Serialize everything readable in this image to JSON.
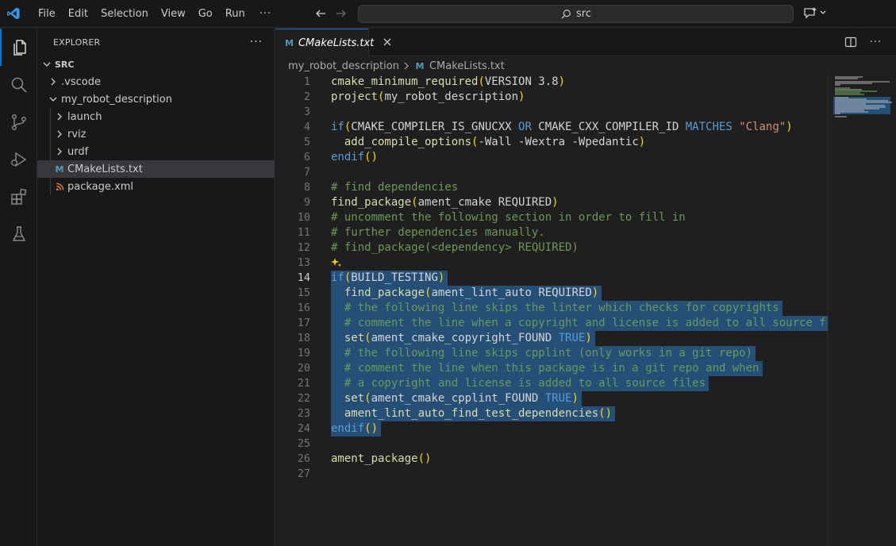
{
  "menu": {
    "file": "File",
    "edit": "Edit",
    "selection": "Selection",
    "view": "View",
    "go": "Go",
    "run": "Run",
    "more": "···"
  },
  "search": {
    "text": "src"
  },
  "explorer": {
    "title": "EXPLORER",
    "root": "SRC",
    "items": [
      {
        "label": ".vscode"
      },
      {
        "label": "my_robot_description"
      },
      {
        "label": "launch"
      },
      {
        "label": "rviz"
      },
      {
        "label": "urdf"
      },
      {
        "label": "CMakeLists.txt"
      },
      {
        "label": "package.xml"
      }
    ]
  },
  "tab": {
    "label": "CMakeLists.txt",
    "icon_letter": "M"
  },
  "breadcrumbs": {
    "folder": "my_robot_description",
    "file": "CMakeLists.txt"
  },
  "colors": {
    "accent": "#0078d4",
    "selection": "#264f78",
    "keyword": "#569cd6",
    "function": "#dcdcaa",
    "comment": "#6a9955",
    "string": "#ce9178"
  },
  "editor": {
    "current_line": 14,
    "lines": [
      {
        "n": "1",
        "tokens": [
          [
            "fn",
            "cmake_minimum_required"
          ],
          [
            "pr",
            "("
          ],
          [
            "pl",
            "VERSION 3.8"
          ],
          [
            "pr",
            ")"
          ]
        ]
      },
      {
        "n": "2",
        "tokens": [
          [
            "fn",
            "project"
          ],
          [
            "pr",
            "("
          ],
          [
            "pl",
            "my_robot_description"
          ],
          [
            "pr",
            ")"
          ]
        ]
      },
      {
        "n": "3",
        "tokens": []
      },
      {
        "n": "4",
        "tokens": [
          [
            "kw",
            "if"
          ],
          [
            "pr",
            "("
          ],
          [
            "pl",
            "CMAKE_COMPILER_IS_GNUCXX "
          ],
          [
            "kw",
            "OR"
          ],
          [
            "pl",
            " CMAKE_CXX_COMPILER_ID "
          ],
          [
            "kw",
            "MATCHES"
          ],
          [
            "pl",
            " "
          ],
          [
            "st",
            "\"Clang\""
          ],
          [
            "pr",
            ")"
          ]
        ]
      },
      {
        "n": "5",
        "tokens": [
          [
            "pl",
            "  "
          ],
          [
            "fn",
            "add_compile_options"
          ],
          [
            "pr",
            "("
          ],
          [
            "pl",
            "-Wall -Wextra -Wpedantic"
          ],
          [
            "pr",
            ")"
          ]
        ]
      },
      {
        "n": "6",
        "tokens": [
          [
            "kw",
            "endif"
          ],
          [
            "pr",
            "()"
          ]
        ]
      },
      {
        "n": "7",
        "tokens": []
      },
      {
        "n": "8",
        "tokens": [
          [
            "cm",
            "# find dependencies"
          ]
        ]
      },
      {
        "n": "9",
        "tokens": [
          [
            "fn",
            "find_package"
          ],
          [
            "pr",
            "("
          ],
          [
            "pl",
            "ament_cmake REQUIRED"
          ],
          [
            "pr",
            ")"
          ]
        ]
      },
      {
        "n": "10",
        "tokens": [
          [
            "cm",
            "# uncomment the following section in order to fill in"
          ]
        ]
      },
      {
        "n": "11",
        "tokens": [
          [
            "cm",
            "# further dependencies manually."
          ]
        ]
      },
      {
        "n": "12",
        "tokens": [
          [
            "cm",
            "# find_package(<dependency> REQUIRED)"
          ]
        ]
      },
      {
        "n": "13",
        "tokens": []
      },
      {
        "n": "14",
        "tokens": [
          [
            "kw",
            "if"
          ],
          [
            "pr",
            "("
          ],
          [
            "pl",
            "BUILD_TESTING"
          ],
          [
            "pr",
            ")"
          ]
        ]
      },
      {
        "n": "15",
        "tokens": [
          [
            "pl",
            "  "
          ],
          [
            "fn",
            "find_package"
          ],
          [
            "pr",
            "("
          ],
          [
            "pl",
            "ament_lint_auto REQUIRED"
          ],
          [
            "pr",
            ")"
          ]
        ]
      },
      {
        "n": "16",
        "tokens": [
          [
            "pl",
            "  "
          ],
          [
            "cm",
            "# the following line skips the linter which checks for copyrights"
          ]
        ]
      },
      {
        "n": "17",
        "tokens": [
          [
            "pl",
            "  "
          ],
          [
            "cm",
            "# comment the line when a copyright and license is added to all source f"
          ]
        ]
      },
      {
        "n": "18",
        "tokens": [
          [
            "pl",
            "  "
          ],
          [
            "fn",
            "set"
          ],
          [
            "pr",
            "("
          ],
          [
            "pl",
            "ament_cmake_copyright_FOUND "
          ],
          [
            "kw",
            "TRUE"
          ],
          [
            "pr",
            ")"
          ]
        ]
      },
      {
        "n": "19",
        "tokens": [
          [
            "pl",
            "  "
          ],
          [
            "cm",
            "# the following line skips cpplint (only works in a git repo)"
          ]
        ]
      },
      {
        "n": "20",
        "tokens": [
          [
            "pl",
            "  "
          ],
          [
            "cm",
            "# comment the line when this package is in a git repo and when"
          ]
        ]
      },
      {
        "n": "21",
        "tokens": [
          [
            "pl",
            "  "
          ],
          [
            "cm",
            "# a copyright and license is added to all source files"
          ]
        ]
      },
      {
        "n": "22",
        "tokens": [
          [
            "pl",
            "  "
          ],
          [
            "fn",
            "set"
          ],
          [
            "pr",
            "("
          ],
          [
            "pl",
            "ament_cmake_cpplint_FOUND "
          ],
          [
            "kw",
            "TRUE"
          ],
          [
            "pr",
            ")"
          ]
        ]
      },
      {
        "n": "23",
        "tokens": [
          [
            "pl",
            "  "
          ],
          [
            "fn",
            "ament_lint_auto_find_test_dependencies"
          ],
          [
            "pr",
            "()"
          ]
        ]
      },
      {
        "n": "24",
        "tokens": [
          [
            "kw",
            "endif"
          ],
          [
            "pr",
            "()"
          ]
        ]
      },
      {
        "n": "25",
        "tokens": []
      },
      {
        "n": "26",
        "tokens": [
          [
            "fn",
            "ament_package"
          ],
          [
            "pr",
            "()"
          ]
        ]
      },
      {
        "n": "27",
        "tokens": []
      }
    ]
  }
}
